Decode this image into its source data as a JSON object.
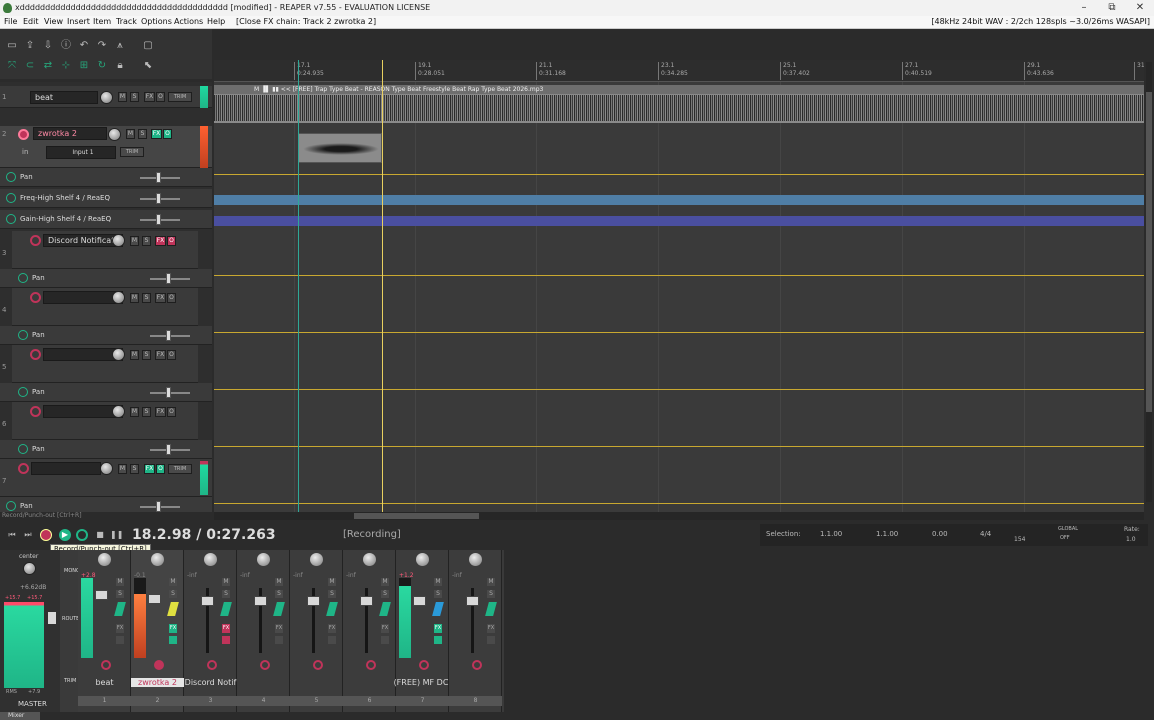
{
  "window": {
    "title": "xddddddddddddddddddddddddddddddddddddddddd [modified] - REAPER v7.55 - EVALUATION LICENSE",
    "minimize": "–",
    "maximize": "⧉",
    "close": "✕"
  },
  "menu": {
    "items": [
      "File",
      "Edit",
      "View",
      "Insert",
      "Item",
      "Track",
      "Options",
      "Actions",
      "Help"
    ],
    "fx_chain": "[Close FX chain: Track 2 zwrotka 2]",
    "audio_status": "[48kHz 24bit WAV : 2/2ch 128spls ~3.0/26ms WASAPI]"
  },
  "tracks": [
    {
      "num": "1",
      "name": "beat"
    },
    {
      "num": "2",
      "name": "zwrotka 2",
      "input": "Input 1"
    },
    {
      "num": "3",
      "name": "Discord Notificati"
    },
    {
      "num": "4",
      "name": ""
    },
    {
      "num": "5",
      "name": ""
    },
    {
      "num": "6",
      "name": ""
    },
    {
      "num": "7",
      "name": ""
    }
  ],
  "envelopes": {
    "pan": "Pan",
    "freq": "Freq-High Shelf 4 / ReaEQ",
    "gain": "Gain-High Shelf 4 / ReaEQ"
  },
  "track_buttons": {
    "m": "M",
    "s": "S",
    "fx": "FX",
    "o": "O",
    "trim": "TRIM",
    "in": "in"
  },
  "ruler": [
    {
      "bar": "17.1",
      "time": "0:24.935"
    },
    {
      "bar": "19.1",
      "time": "0:28.051"
    },
    {
      "bar": "21.1",
      "time": "0:31.168"
    },
    {
      "bar": "23.1",
      "time": "0:34.285"
    },
    {
      "bar": "25.1",
      "time": "0:37.402"
    },
    {
      "bar": "27.1",
      "time": "0:40.519"
    },
    {
      "bar": "29.1",
      "time": "0:43.636"
    },
    {
      "bar": "31",
      "time": ""
    }
  ],
  "item_beat_label": "M  ▐▌  ▮▮  << [FREE] Trap Type Beat - REASON Type Beat Freestyle Beat Rap Type Beat 2026.mp3",
  "transport": {
    "time": "18.2.98 / 0:27.263",
    "status": "[Recording]",
    "tooltip": "Record/Punch-out [Ctrl+R]",
    "hint": "Record/Punch-out [Ctrl+R]"
  },
  "selection": {
    "label": "Selection:",
    "start": "1.1.00",
    "end": "1.1.00",
    "length": "0.00",
    "timesig": "4/4",
    "bpm": "154",
    "global": "GLOBAL",
    "global_state": "OFF",
    "rate_label": "Rate:",
    "rate": "1.0"
  },
  "mixer": {
    "master_label": "MASTER",
    "center": "center",
    "master_db": "+6.62dB",
    "master_peak_l": "+15.7",
    "master_peak_r": "+15.7",
    "route": "ROUTE",
    "mono": "MONO",
    "trim": "TRIM",
    "rms": "RMS",
    "rms_val": "+7.9",
    "tab": "Mixer",
    "strips": [
      {
        "name": "beat",
        "no": "1",
        "db": "+2.8"
      },
      {
        "name": "zwrotka 2",
        "no": "2",
        "db": "-0.1"
      },
      {
        "name": "Discord Notif",
        "no": "3",
        "db": "-inf"
      },
      {
        "name": "",
        "no": "4",
        "db": "-inf"
      },
      {
        "name": "",
        "no": "5",
        "db": "-inf"
      },
      {
        "name": "",
        "no": "6",
        "db": "-inf"
      },
      {
        "name": "(FREE) MF DC",
        "no": "7",
        "db": "+1.2"
      },
      {
        "name": "",
        "no": "8",
        "db": "-inf"
      }
    ]
  },
  "colors": {
    "accent_green": "#1fb587",
    "accent_red": "#c0345a",
    "cursor_yellow": "#e8d060"
  }
}
